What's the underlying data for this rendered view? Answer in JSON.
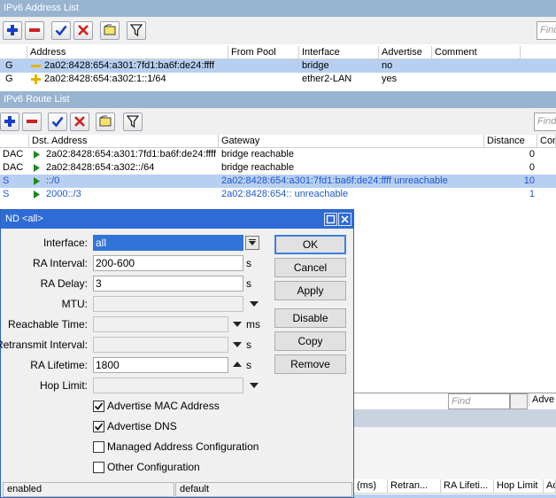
{
  "addr_window": {
    "title": "IPv6 Address List",
    "find_placeholder": "Find",
    "columns": [
      "Address",
      "From Pool",
      "Interface",
      "Advertise",
      "Comment"
    ],
    "rows": [
      {
        "flag": "G",
        "address": "2a02:8428:654:a301:7fd1:ba6f:de24:ffff",
        "from_pool": "",
        "interface": "bridge",
        "advertise": "no",
        "comment": ""
      },
      {
        "flag": "G",
        "address": "2a02:8428:654:a302:1::1/64",
        "from_pool": "",
        "interface": "ether2-LAN",
        "advertise": "yes",
        "comment": ""
      }
    ]
  },
  "route_window": {
    "title": "IPv6 Route List",
    "find_placeholder": "Find",
    "columns": [
      "Dst. Address",
      "Gateway",
      "Distance",
      "Com"
    ],
    "rows": [
      {
        "flag": "DAC",
        "dst": "2a02:8428:654:a301:7fd1:ba6f:de24:ffff",
        "gateway": "bridge reachable",
        "distance": "0"
      },
      {
        "flag": "DAC",
        "dst": "2a02:8428:654:a302::/64",
        "gateway": "bridge reachable",
        "distance": "0"
      },
      {
        "flag": "S",
        "dst": "::/0",
        "gateway": "2a02:8428:654:a301:7fd1:ba6f:de24:ffff unreachable",
        "distance": "10"
      },
      {
        "flag": "S",
        "dst": "2000::/3",
        "gateway": "2a02:8428:654:: unreachable",
        "distance": "1"
      }
    ]
  },
  "behind_window": {
    "find_placeholder": "Find",
    "column_partial": "Adve",
    "columns": [
      "(ms)",
      "Retran...",
      "RA Lifeti...",
      "Hop Limit",
      "Ad"
    ]
  },
  "nd_dialog": {
    "title": "ND <all>",
    "fields": {
      "interface": {
        "label": "Interface:",
        "value": "all"
      },
      "ra_interval": {
        "label": "RA Interval:",
        "value": "200-600",
        "unit": "s"
      },
      "ra_delay": {
        "label": "RA Delay:",
        "value": "3",
        "unit": "s"
      },
      "mtu": {
        "label": "MTU:",
        "value": ""
      },
      "reachable_time": {
        "label": "Reachable Time:",
        "value": "",
        "unit": "ms"
      },
      "retransmit_interval": {
        "label": "Retransmit Interval:",
        "value": "",
        "unit": "s"
      },
      "ra_lifetime": {
        "label": "RA Lifetime:",
        "value": "1800",
        "unit": "s"
      },
      "hop_limit": {
        "label": "Hop Limit:",
        "value": ""
      }
    },
    "checkboxes": [
      {
        "label": "Advertise MAC Address",
        "checked": true
      },
      {
        "label": "Advertise DNS",
        "checked": true
      },
      {
        "label": "Managed Address Configuration",
        "checked": false
      },
      {
        "label": "Other Configuration",
        "checked": false
      }
    ],
    "buttons": {
      "ok": "OK",
      "cancel": "Cancel",
      "apply": "Apply",
      "disable": "Disable",
      "copy": "Copy",
      "remove": "Remove"
    },
    "status": {
      "left": "enabled",
      "right": "default"
    }
  },
  "colors": {
    "title_inactive": "#99b4d1",
    "title_active": "#2d6bd6",
    "selection": "#b7cff0",
    "link_blue": "#1e58d2",
    "add_icon": "#1a3ec8",
    "remove_icon": "#d02020"
  }
}
